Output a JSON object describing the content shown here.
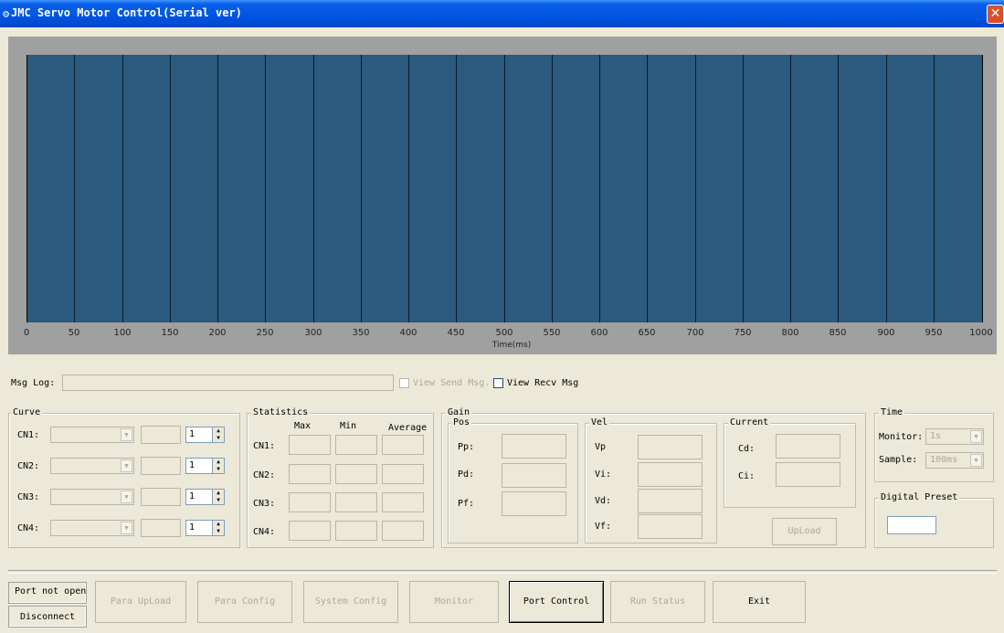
{
  "window": {
    "title": "JMC Servo Motor Control(Serial ver)",
    "close_label": "✕"
  },
  "chart_data": {
    "type": "line",
    "xlabel": "Time(ms)",
    "xlim": [
      0,
      1000
    ],
    "x_ticks": [
      "0",
      "50",
      "100",
      "150",
      "200",
      "250",
      "300",
      "350",
      "400",
      "450",
      "500",
      "550",
      "600",
      "650",
      "700",
      "750",
      "800",
      "850",
      "900",
      "950",
      "1000"
    ],
    "series": [],
    "grid": true,
    "background": "#2a5a7e"
  },
  "msg_log": {
    "label": "Msg Log:",
    "value": "",
    "view_send_label": "View Send Msg.",
    "view_recv_label": "View Recv Msg"
  },
  "curve": {
    "title": "Curve",
    "rows": [
      {
        "label": "CN1:",
        "spin": "1"
      },
      {
        "label": "CN2:",
        "spin": "1"
      },
      {
        "label": "CN3:",
        "spin": "1"
      },
      {
        "label": "CN4:",
        "spin": "1"
      }
    ]
  },
  "statistics": {
    "title": "Statistics",
    "headers": [
      "Max",
      "Min",
      "Average"
    ],
    "rows": [
      "CN1:",
      "CN2:",
      "CN3:",
      "CN4:"
    ]
  },
  "gain": {
    "title": "Gain",
    "pos": {
      "title": "Pos",
      "labels": [
        "Pp:",
        "Pd:",
        "Pf:"
      ]
    },
    "vel": {
      "title": "Vel",
      "labels": [
        "Vp",
        "Vi:",
        "Vd:",
        "Vf:"
      ]
    },
    "current": {
      "title": "Current",
      "labels": [
        "Cd:",
        "Ci:"
      ],
      "upload_label": "UpLoad"
    }
  },
  "time": {
    "title": "Time",
    "monitor_label": "Monitor:",
    "monitor_value": "1s",
    "sample_label": "Sample:",
    "sample_value": "100ms"
  },
  "digital_preset": {
    "title": "Digital Preset",
    "value": ""
  },
  "status": {
    "port_state": "Port not open",
    "connection": "Disconnect"
  },
  "toolbar": {
    "para_upload": "Para UpLoad",
    "para_config": "Para Config",
    "system_config": "System Config",
    "monitor": "Monitor",
    "port_control": "Port Control",
    "run_status": "Run Status",
    "exit": "Exit"
  }
}
